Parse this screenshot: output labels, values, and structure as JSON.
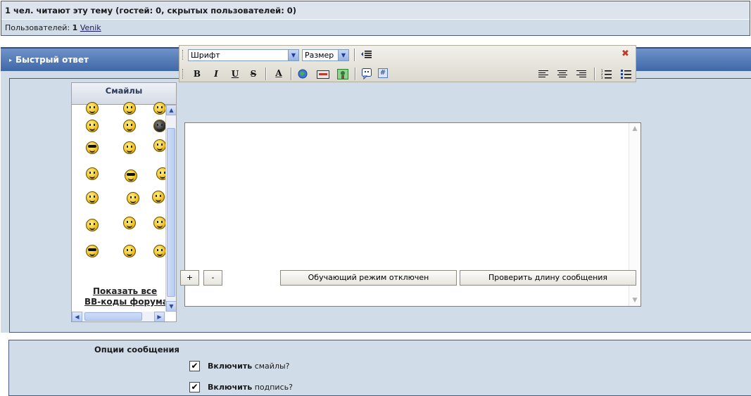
{
  "info": {
    "readers": "1 чел. читают эту тему (гостей: 0, скрытых пользователей: 0)",
    "users_label": "Пользователей:",
    "users_count": "1",
    "user_name": "Venik"
  },
  "quick_reply": {
    "title": "Быстрый ответ"
  },
  "toolbar": {
    "font_select": "Шрифт",
    "size_select": "Размер",
    "bold": "B",
    "italic": "I",
    "underline": "U",
    "strike": "S",
    "color": "A",
    "hash": "#"
  },
  "smilies": {
    "title": "Смайлы",
    "show_all": "Показать все",
    "bb_codes": "BB-коды форума"
  },
  "editor": {
    "plus": "+",
    "minus": "-",
    "learning_mode": "Обучающий режим отключен",
    "check_length": "Проверить длину сообщения"
  },
  "options": {
    "label": "Опции сообщения",
    "items": [
      {
        "bold": "Включить",
        "text": "смайлы?"
      },
      {
        "bold": "Включить",
        "text": "подпись?"
      }
    ]
  },
  "colors": {
    "header_blue": "#4a70ae",
    "panel_bg": "#d1dce9",
    "close_red": "#c0392b"
  }
}
